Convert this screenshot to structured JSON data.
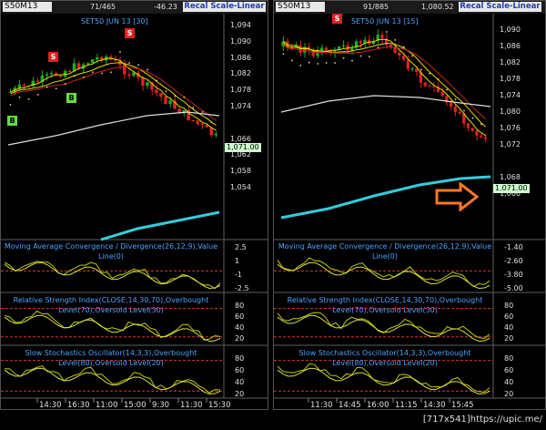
{
  "left": {
    "symbol": "S50M13",
    "top_values": [
      "71/465",
      "-46.23"
    ],
    "recal_label": "Recal Scale-Linear",
    "chart_title": "SET50 JUN 13   [30]",
    "price_axis": [
      "1,094",
      "1,090",
      "1,086",
      "1,082",
      "1,078",
      "1,074",
      "1,071.00",
      "1,066",
      "1,062",
      "1,058",
      "1,054"
    ],
    "current_price": "1,071.00",
    "signals": [
      {
        "type": "S",
        "kind": "sell"
      },
      {
        "type": "S",
        "kind": "sell"
      },
      {
        "type": "B",
        "kind": "buy"
      },
      {
        "type": "B",
        "kind": "buy"
      }
    ],
    "macd_title": "Moving Average Convergence / Divergence(26,12,9),Value Line(0)",
    "macd_axis": [
      "2.5",
      "1",
      "-1",
      "-2.5"
    ],
    "rsi_title": "Relative Strength Index(CLOSE,14,30,70),Overbought Level(70),Oversold Level(30)",
    "rsi_axis": [
      "80",
      "60",
      "40",
      "20"
    ],
    "stoch_title": "Slow Stochastics Oscillator(14,3,3),Overbought Level(80),Oversold Level(20)",
    "stoch_axis": [
      "80",
      "60",
      "40",
      "20"
    ],
    "time_axis": [
      "14:30",
      "16:30",
      "11:00",
      "15:00",
      "9:30",
      "11:30",
      "15:30"
    ]
  },
  "right": {
    "symbol": "S50M13",
    "top_values": [
      "91/885",
      "1,080.52"
    ],
    "recal_label": "Recal Scale-Linear",
    "chart_title": "SET50 JUN 13   [15]",
    "price_axis": [
      "1,090",
      "1,086",
      "1,082",
      "1,078",
      "1,074",
      "1,080",
      "1,076",
      "1,072",
      "1,071.00",
      "1,068",
      "1,066"
    ],
    "current_price": "1,071.00",
    "signals": [
      {
        "type": "S",
        "kind": "sell"
      }
    ],
    "macd_title": "Moving Average Convergence / Divergence(26,12,9),Value Line(0)",
    "macd_axis": [
      "-1.40",
      "-2.60",
      "-3.80",
      "-5.00"
    ],
    "rsi_title": "Relative Strength Index(CLOSE,14,30,70),Overbought Level(70),Oversold Level(30)",
    "rsi_axis": [
      "80",
      "60",
      "40",
      "20"
    ],
    "stoch_title": "Slow Stochastics Oscillator(14,3,3),Overbought Level(80),Oversold Level(20)",
    "stoch_axis": [
      "80",
      "60",
      "40",
      "20"
    ],
    "time_axis": [
      "11:30",
      "14:45",
      "16:00",
      "11:15",
      "14:30",
      "15:45"
    ]
  },
  "watermark": "[717x541]https://upic.me/",
  "colors": {
    "bull": "#22aa22",
    "bear": "#dd2222",
    "ema_fast": "#dddd00",
    "ema_slow": "#cc2222",
    "ma_long": "#dddddd",
    "ma_cyan": "#33ccdd",
    "sar": "#ffcc99",
    "arrow": "#ff7722",
    "title": "#4aa3ff"
  }
}
